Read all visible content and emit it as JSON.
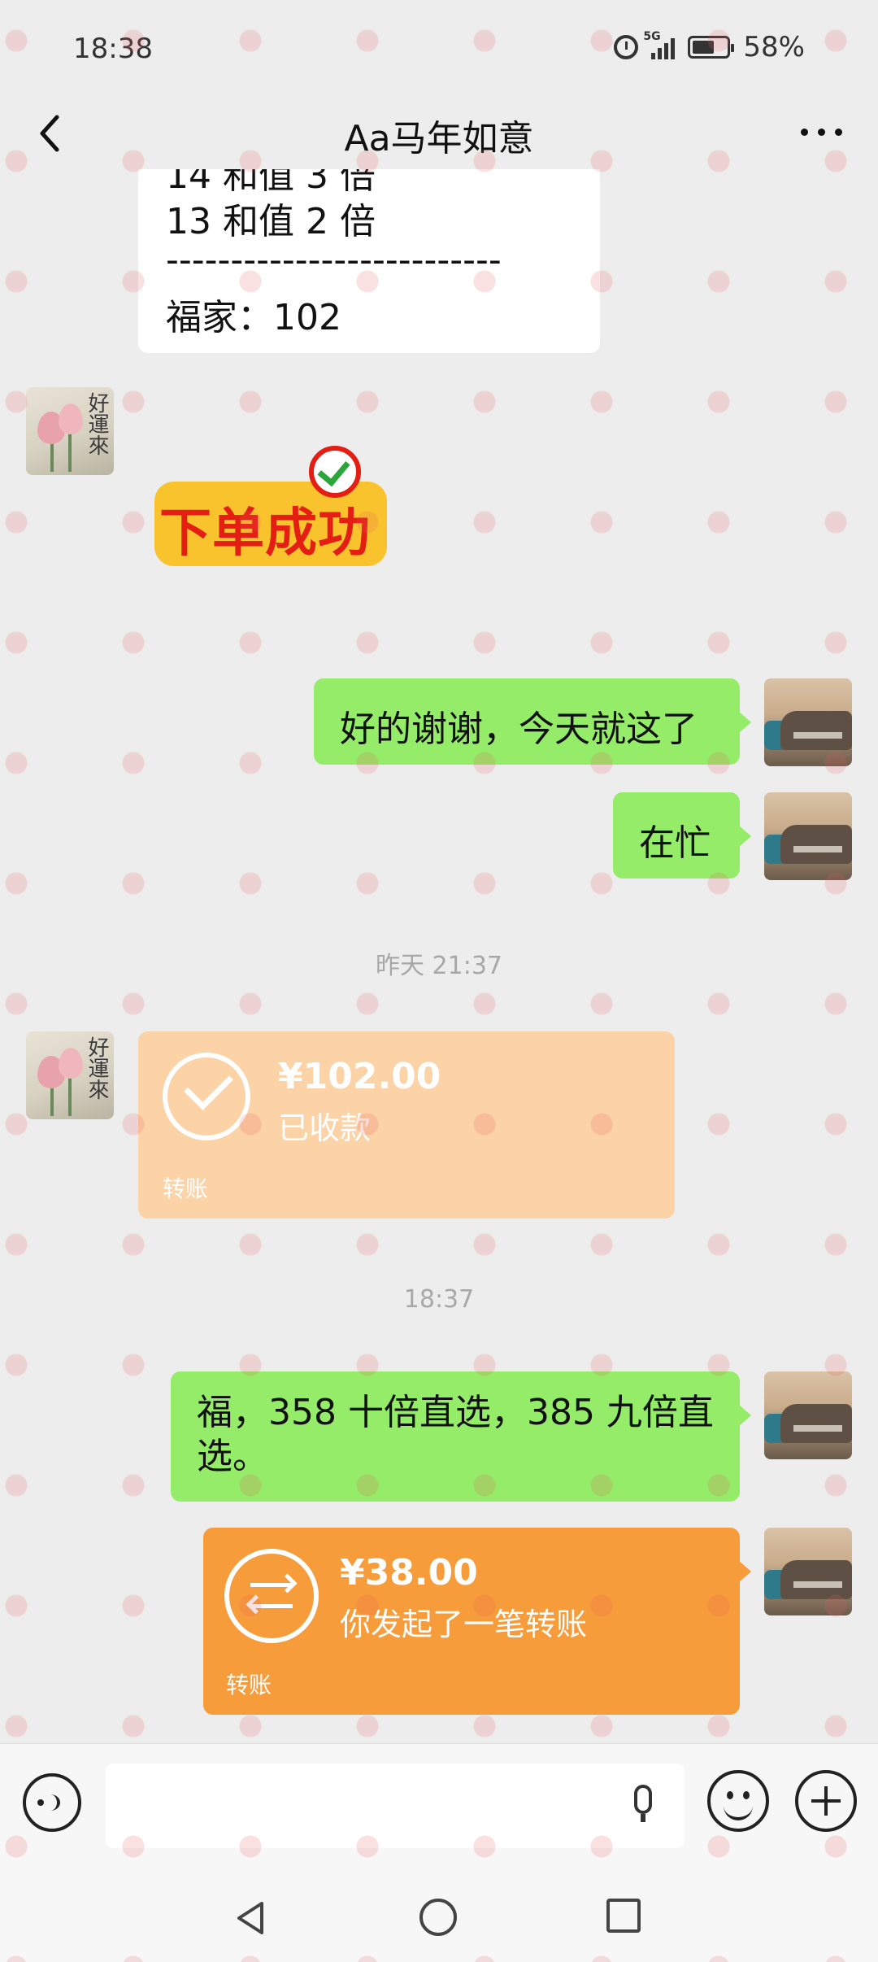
{
  "status": {
    "time": "18:38",
    "network": "5G",
    "battery": "58%"
  },
  "header": {
    "title": "Aa马年如意"
  },
  "messages": {
    "partial_card": {
      "line_cut": "14 和值 3 倍",
      "line1": "13 和值 2 倍",
      "divider": "--------------------------",
      "line2": "福家：102"
    },
    "sticker_text": "下单成功",
    "sent1": "好的谢谢，今天就这了",
    "sent2": "在忙",
    "time1": "昨天 21:37",
    "transfer_received": {
      "amount": "¥102.00",
      "status": "已收款",
      "type": "转账"
    },
    "time2": "18:37",
    "sent3": "福，358 十倍直选，385 九倍直选。",
    "transfer_sent": {
      "amount": "¥38.00",
      "status": "你发起了一笔转账",
      "type": "转账"
    },
    "avatar_left_text": "好運來"
  },
  "input": {
    "placeholder": ""
  },
  "colors": {
    "background": "#ededed",
    "sent_bubble": "#95ec69",
    "transfer_active": "#f79c3b",
    "transfer_received": "#fcd2a7",
    "sticker_bg": "#f9c32d",
    "sticker_text": "#e51e14"
  },
  "icons": [
    "back-icon",
    "more-icon",
    "voice-icon",
    "mic-icon",
    "emoji-icon",
    "plus-icon",
    "alarm-icon",
    "signal-icon",
    "battery-icon",
    "checkmark-icon",
    "transfer-arrows-icon"
  ]
}
